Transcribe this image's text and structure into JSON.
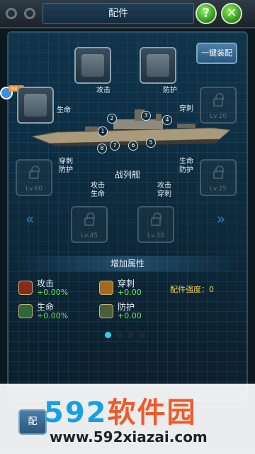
{
  "header": {
    "title": "配件",
    "help_label": "?",
    "close_label": "✕"
  },
  "actions": {
    "one_key_equip": "一键装配",
    "bottom_button": "配"
  },
  "side": {
    "badge_tag": "领礼包"
  },
  "ship": {
    "type_label": "战列舰"
  },
  "slots": {
    "top_left_label": "攻击",
    "top_right_label": "防护",
    "left_label": "生命",
    "right_label": "穿刺",
    "right_level": "Lv.20",
    "left_mid_label_1": "穿刺",
    "left_mid_label_2": "防护",
    "left_mid_level": "Lv.60",
    "right_mid_label_1": "生命",
    "right_mid_label_2": "防护",
    "right_mid_level": "Lv.25",
    "bottom_left_label_1": "攻击",
    "bottom_left_label_2": "生命",
    "bottom_left_level": "Lv.45",
    "bottom_right_label_1": "攻击",
    "bottom_right_label_2": "穿刺",
    "bottom_right_level": "Lv.30"
  },
  "markers": [
    "1",
    "2",
    "3",
    "4",
    "5",
    "6",
    "7",
    "8"
  ],
  "attributes": {
    "header": "增加属性",
    "attack": {
      "name": "攻击",
      "value": "+0.00%"
    },
    "pierce": {
      "name": "穿刺",
      "value": "+0.00"
    },
    "life": {
      "name": "生命",
      "value": "+0.00%"
    },
    "defense": {
      "name": "防护",
      "value": "+0.00"
    },
    "strength": "配件强度：0"
  },
  "pager": {
    "active_index": 0,
    "count": 4
  },
  "watermark": {
    "logo_num": "592",
    "logo_text": "软件园",
    "url": "www.592xiazai.com"
  },
  "colors": {
    "accent_green": "#6ee858",
    "strength_yellow": "#f6d24a",
    "panel_blue": "#10344a"
  }
}
